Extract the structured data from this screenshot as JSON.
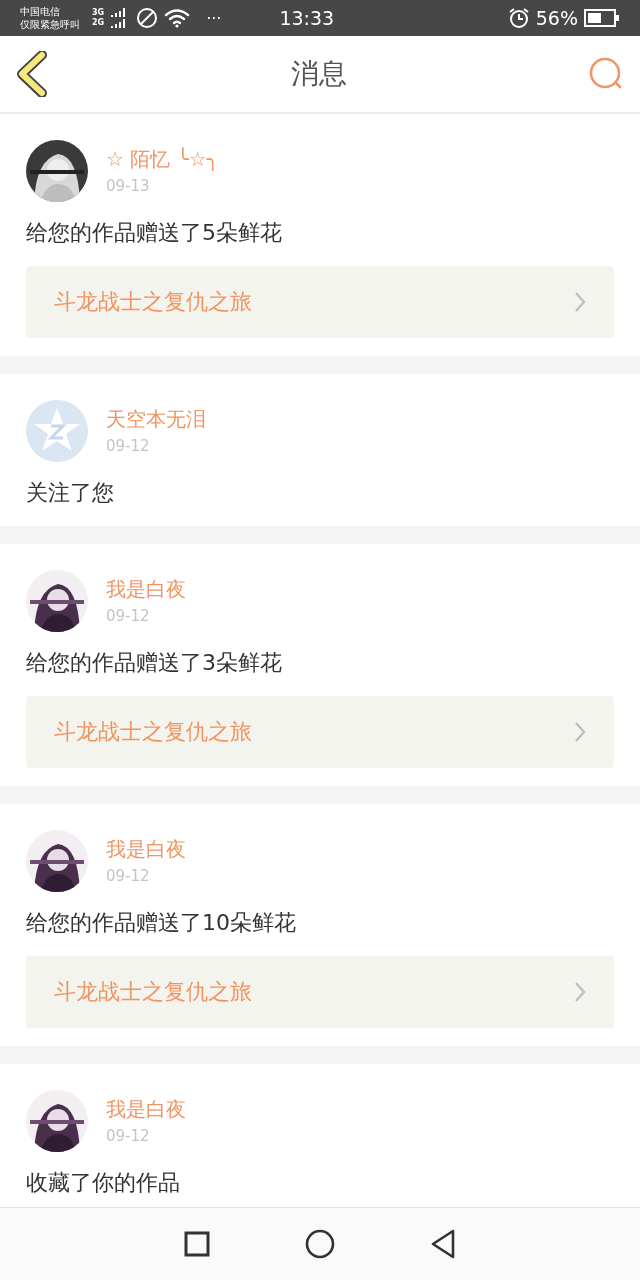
{
  "status_bar": {
    "carrier": "中国电信",
    "carrier_note": "仅限紧急呼叫",
    "network_top": "3G",
    "network_bottom": "2G",
    "dots": "···",
    "time": "13:33",
    "battery": "56%"
  },
  "header": {
    "title": "消息"
  },
  "messages": [
    {
      "name": "☆ 陌忆 ╰☆╮",
      "date": "09-13",
      "text": "给您的作品赠送了5朵鲜花",
      "work": "斗龙战士之复仇之旅"
    },
    {
      "avatar": {
        "kind": "default"
      },
      "name": "天空本无泪",
      "date": "09-12",
      "text": "关注了您"
    },
    {
      "name": "我是白夜",
      "date": "09-12",
      "text": "给您的作品赠送了3朵鲜花",
      "work": "斗龙战士之复仇之旅"
    },
    {
      "name": "我是白夜",
      "date": "09-12",
      "text": "给您的作品赠送了10朵鲜花",
      "work": "斗龙战士之复仇之旅"
    },
    {
      "name": "我是白夜",
      "date": "09-12",
      "text": "收藏了你的作品"
    }
  ]
}
